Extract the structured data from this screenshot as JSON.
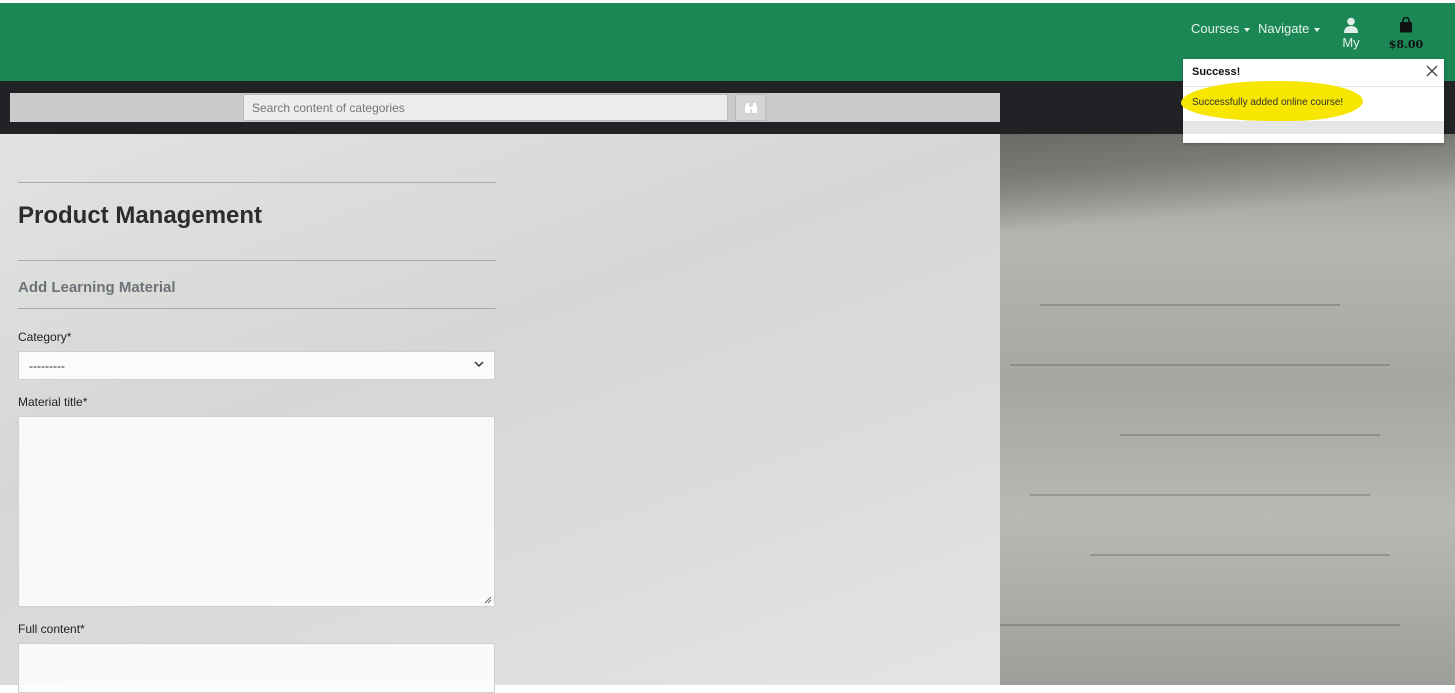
{
  "nav": {
    "courses": "Courses",
    "navigate": "Navigate",
    "account_label": "My",
    "cart_total": "$8.00"
  },
  "search": {
    "placeholder": "Search content of categories"
  },
  "page": {
    "title": "Product Management",
    "section": "Add Learning Material"
  },
  "form": {
    "category_label": "Category*",
    "category_value": "---------",
    "title_label": "Material title*",
    "content_label": "Full content*"
  },
  "toast": {
    "title": "Success!",
    "message": "Successfully added online course!"
  },
  "colors": {
    "topbar": "#1b8754",
    "searchbar": "#212226",
    "highlight": "#f6e600"
  }
}
